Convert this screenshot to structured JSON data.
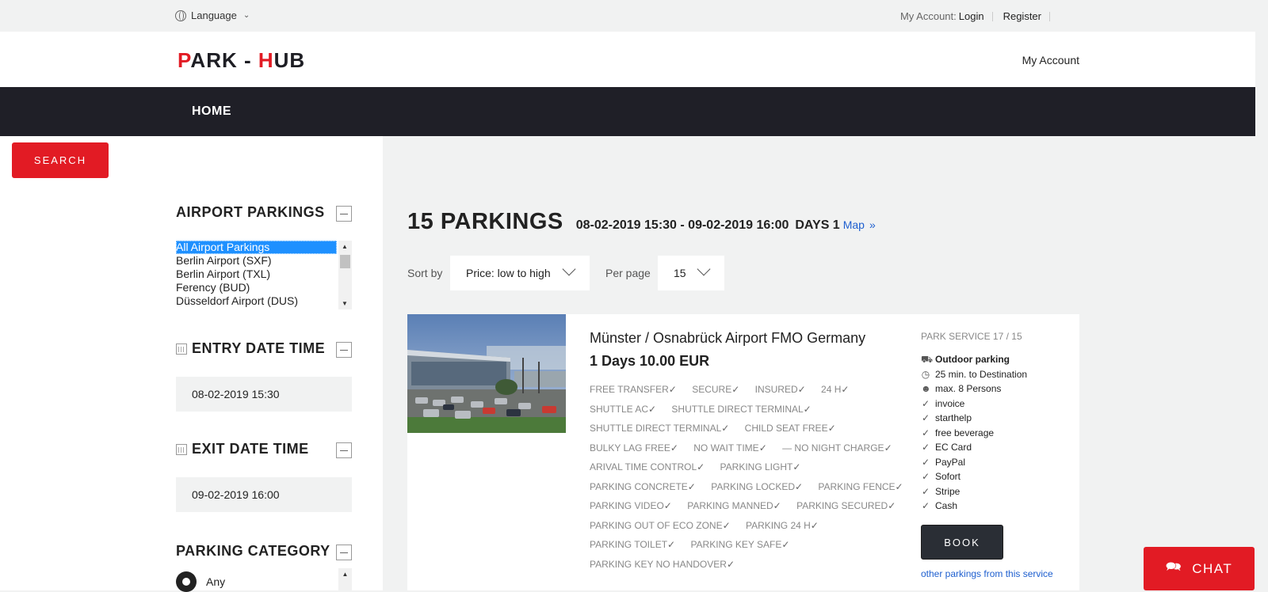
{
  "topbar": {
    "language_label": "Language",
    "account_label": "My Account:",
    "login": "Login",
    "register": "Register"
  },
  "header": {
    "logo_p": "P",
    "logo_mid": "ARK - ",
    "logo_h": "H",
    "logo_end": "UB",
    "account": "My Account"
  },
  "nav": {
    "home": "HOME"
  },
  "sidebar": {
    "search_button": "SEARCH",
    "airport_title": "AIRPORT PARKINGS",
    "airports": [
      "All Airport Parkings",
      "Berlin Airport (SXF)",
      "Berlin Airport (TXL)",
      "Ferency (BUD)",
      "Düsseldorf Airport (DUS)"
    ],
    "entry_title": "ENTRY DATE TIME",
    "entry_value": "08-02-2019 15:30",
    "exit_title": "EXIT DATE TIME",
    "exit_value": "09-02-2019 16:00",
    "category_title": "PARKING CATEGORY",
    "category_option": "Any"
  },
  "results": {
    "count": "15 PARKINGS",
    "dates": "08-02-2019 15:30 - 09-02-2019 16:00",
    "days": "DAYS 1",
    "map": "Map",
    "map_arrow": "»",
    "sort_label": "Sort by",
    "sort_value": "Price: low to high",
    "per_page_label": "Per page",
    "per_page_value": "15"
  },
  "listing": {
    "title": "Münster / Osnabrück Airport FMO Germany",
    "price": "1 Days 10.00 EUR",
    "features": [
      [
        "FREE TRANSFER",
        "SECURE",
        "INSURED",
        "24 H"
      ],
      [
        "SHUTTLE AC",
        "SHUTTLE DIRECT TERMINAL"
      ],
      [
        "SHUTTLE DIRECT TERMINAL",
        "CHILD SEAT FREE"
      ],
      [
        "BULKY LAG FREE",
        "NO WAIT TIME",
        "— NO NIGHT CHARGE"
      ],
      [
        "ARIVAL TIME CONTROL",
        "PARKING LIGHT"
      ],
      [
        "PARKING CONCRETE",
        "PARKING LOCKED",
        "PARKING FENCE"
      ],
      [
        "PARKING VIDEO",
        "PARKING MANNED",
        "PARKING SECURED"
      ],
      [
        "PARKING OUT OF ECO ZONE",
        "PARKING 24 H"
      ],
      [
        "PARKING TOILET",
        "PARKING KEY SAFE"
      ],
      [
        "PARKING KEY NO HANDOVER"
      ]
    ],
    "service": "PARK SERVICE 17 / 15",
    "parking_type": "Outdoor parking",
    "distance": "25 min. to Destination",
    "persons": "max. 8 Persons",
    "amenities": [
      "invoice",
      "starthelp",
      "free beverage",
      "EC Card",
      "PayPal",
      "Sofort",
      "Stripe",
      "Cash"
    ],
    "book": "BOOK",
    "other_link": "other parkings from this service"
  },
  "chat": {
    "label": "CHAT"
  },
  "colors": {
    "accent": "#e21b24",
    "nav": "#1f1f27",
    "link": "#1e5fcf"
  }
}
